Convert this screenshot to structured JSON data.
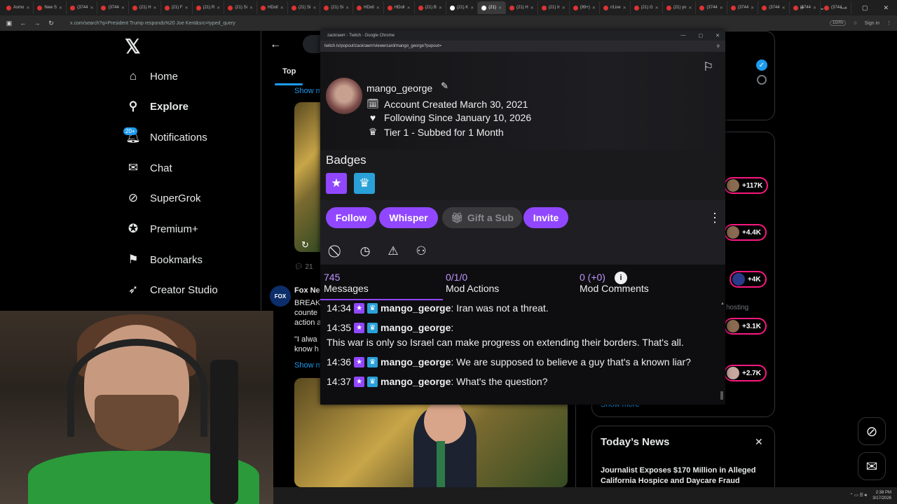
{
  "browser": {
    "tabs": [
      {
        "label": "Asmo"
      },
      {
        "label": "New S"
      },
      {
        "label": "(3744"
      },
      {
        "label": "(3744"
      },
      {
        "label": "(21) H"
      },
      {
        "label": "(21) F"
      },
      {
        "label": "(21) R"
      },
      {
        "label": "(21) Si"
      },
      {
        "label": "HDoll"
      },
      {
        "label": "(21) Si"
      },
      {
        "label": "(21) Si"
      },
      {
        "label": "HDoll"
      },
      {
        "label": "HDoll"
      },
      {
        "label": "(21) B"
      },
      {
        "label": "(21) K"
      },
      {
        "label": "(21)"
      },
      {
        "label": "(21) H"
      },
      {
        "label": "(21) Ir"
      },
      {
        "label": "(99+)"
      },
      {
        "label": "r/Live"
      },
      {
        "label": "(21) G"
      },
      {
        "label": "(21) yo"
      },
      {
        "label": "(3744"
      },
      {
        "label": "(3744"
      },
      {
        "label": "(3744"
      },
      {
        "label": "(3744"
      },
      {
        "label": "(3744"
      }
    ],
    "url": "x.com/search?q=President Trump responds%20 Joe Kent&src=typed_query",
    "zoom": "150%",
    "signin": "Sign in"
  },
  "x_nav": {
    "items": [
      {
        "label": "Home"
      },
      {
        "label": "Explore"
      },
      {
        "label": "Notifications"
      },
      {
        "label": "Chat"
      },
      {
        "label": "SuperGrok"
      },
      {
        "label": "Premium+"
      },
      {
        "label": "Bookmarks"
      },
      {
        "label": "Creator Studio"
      }
    ],
    "notif_badge": "20+"
  },
  "feed": {
    "tab_top": "Top",
    "show_more_1": "Show m",
    "reply_count": "21",
    "post2_author": "Fox Ne",
    "post2_lines": [
      "BREAK",
      "counte",
      "action a"
    ],
    "post2_quote_1": "\"I alwa",
    "post2_quote_2": "know h",
    "show_more_2": "Show m"
  },
  "right": {
    "stats": [
      "+117K",
      "+4.4K",
      "+4K",
      "+3.1K",
      "+2.7K"
    ],
    "hosting": "hosting",
    "show_more": "Show more",
    "news_title": "Today’s News",
    "news_headline": "Journalist Exposes $170 Million in Alleged California Hospice and Daycare Fraud"
  },
  "popup": {
    "window_title": "zackrawrr - Twitch - Google Chrome",
    "url": "twitch.tv/popout/zackrawrr/viewercard/mango_george?popout=",
    "username": "mango_george",
    "account_created": "Account Created March 30, 2021",
    "following_since": "Following Since January 10, 2026",
    "tier": "Tier 1 - Subbed for 1 Month",
    "badges_title": "Badges",
    "buttons": {
      "follow": "Follow",
      "whisper": "Whisper",
      "gift": "Gift a Sub",
      "invite": "Invite"
    },
    "stats": {
      "messages_num": "745",
      "messages_label": "Messages",
      "mod_actions_num": "0/1/0",
      "mod_actions_label": "Mod Actions",
      "mod_comments_num": "0 (+0)",
      "mod_comments_label": "Mod Comments"
    },
    "chat": [
      {
        "time": "14:34",
        "name": "mango_george",
        "text": ": Iran was not a threat."
      },
      {
        "time": "14:35",
        "name": "mango_george",
        "text": ":"
      },
      {
        "time": "",
        "name": "",
        "text": "This war is only so Israel can make progress on extending their borders. That's all."
      },
      {
        "time": "14:36",
        "name": "mango_george",
        "text": ": We are supposed to believe a guy that's a known liar?"
      },
      {
        "time": "14:37",
        "name": "mango_george",
        "text": ": What's the question?"
      }
    ]
  },
  "taskbar": {
    "time": "2:38 PM",
    "date": "3/17/2026"
  },
  "colors": {
    "twitch_purple": "#9147ff",
    "x_blue": "#1d9bf0",
    "pink": "#f91880"
  }
}
